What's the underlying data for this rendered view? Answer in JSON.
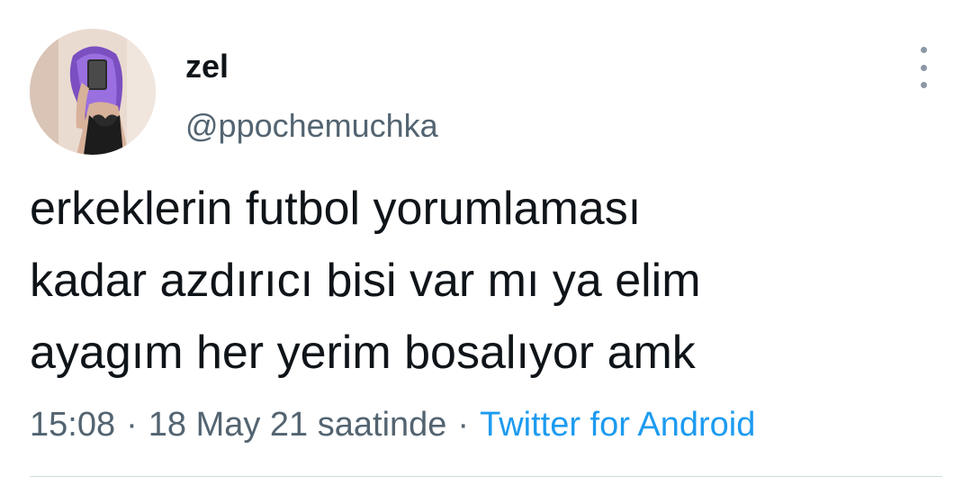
{
  "tweet": {
    "author": {
      "display_name": "zel",
      "handle": "@ppochemuchka"
    },
    "text_lines": [
      "erkeklerin futbol yorumlaması",
      "kadar azdırıcı bisi var mı ya elim",
      "ayagım her yerim bosalıyor amk"
    ],
    "time": "15:08",
    "date_suffix": "18 May 21 saatinde",
    "separator": "·",
    "source": "Twitter for Android"
  },
  "colors": {
    "text_primary": "#0f1419",
    "text_secondary": "#536471",
    "link": "#1d9bf0",
    "divider": "#cfd9de"
  },
  "icons": {
    "more": "more-vertical-icon"
  }
}
